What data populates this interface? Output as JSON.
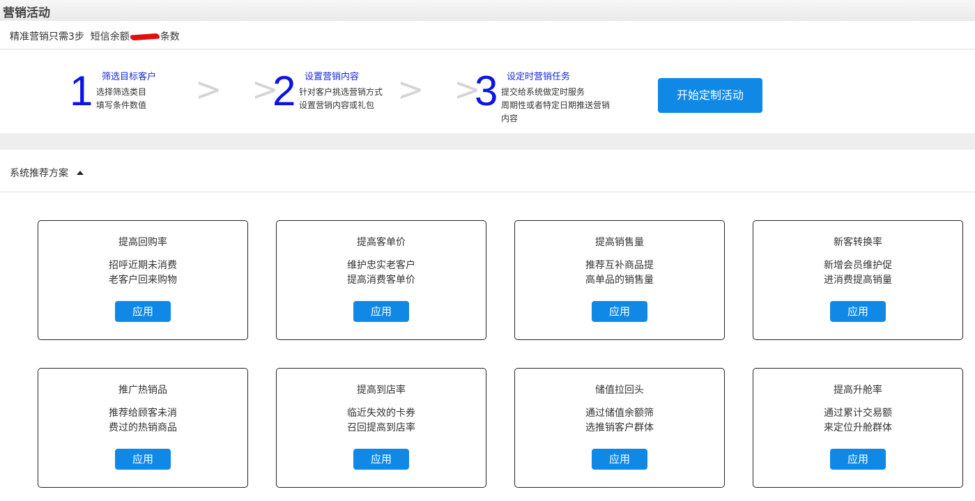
{
  "page": {
    "title": "营销活动"
  },
  "info": {
    "prefix": "精准营销只需3步  短信余额",
    "suffix": "条数"
  },
  "steps": [
    {
      "num": "1",
      "heading": "筛选目标客户",
      "desc1": "选择筛选类目",
      "desc2": "填写条件数值",
      "desc3": ""
    },
    {
      "num": "2",
      "heading": "设置营销内容",
      "desc1": "针对客户挑选营销方式",
      "desc2": "设置营销内容或礼包",
      "desc3": ""
    },
    {
      "num": "3",
      "heading": "设定时营销任务",
      "desc1": "提交给系统做定时服务",
      "desc2": "周期性或者特定日期推送营销",
      "desc3": "内容"
    }
  ],
  "arrows": "> >",
  "start_button": "开始定制活动",
  "recommend": {
    "label": "系统推荐方案"
  },
  "cards": [
    {
      "title": "提高回购率",
      "line1": "招呼近期未消费",
      "line2": "老客户回来购物",
      "button": "应用"
    },
    {
      "title": "提高客单价",
      "line1": "维护忠实老客户",
      "line2": "提高消费客单价",
      "button": "应用"
    },
    {
      "title": "提高销售量",
      "line1": "推荐互补商品提",
      "line2": "高单品的销售量",
      "button": "应用"
    },
    {
      "title": "新客转换率",
      "line1": "新增会员维护促",
      "line2": "进消费提高销量",
      "button": "应用"
    },
    {
      "title": "推广热销品",
      "line1": "推荐给顾客未消",
      "line2": "费过的热销商品",
      "button": "应用"
    },
    {
      "title": "提高到店率",
      "line1": "临近失效的卡券",
      "line2": "召回提高到店率",
      "button": "应用"
    },
    {
      "title": "储值拉回头",
      "line1": "通过储值余额筛",
      "line2": "选推销客户群体",
      "button": "应用"
    },
    {
      "title": "提高升舱率",
      "line1": "通过累计交易额",
      "line2": "来定位升舱群体",
      "button": "应用"
    }
  ],
  "colors": {
    "accent": "#1088e6",
    "step_number": "#0a14e6",
    "step_heading": "#1a2ad8",
    "redaction": "#e01010"
  }
}
